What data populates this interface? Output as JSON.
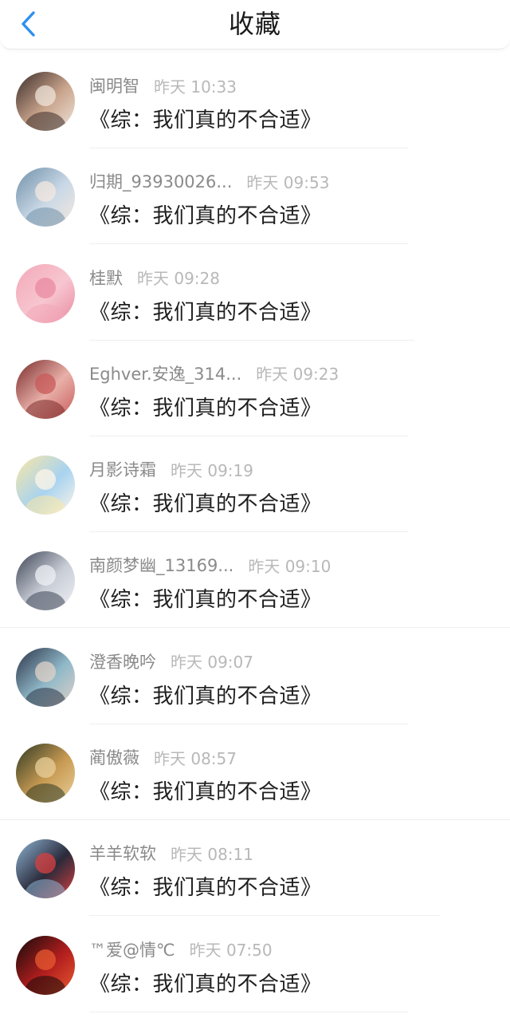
{
  "header": {
    "title": "收藏",
    "back_icon": "chevron-left-icon",
    "accent_color": "#2f8ff0"
  },
  "items": [
    {
      "name": "闽明智",
      "time": "昨天 10:33",
      "message": "《综：我们真的不合适》",
      "avatar_colors": [
        "#3a2c28",
        "#c9a48c",
        "#efe4da"
      ]
    },
    {
      "name": "归期_93930026...",
      "time": "昨天 09:53",
      "message": "《综：我们真的不合适》",
      "avatar_colors": [
        "#6f8fa8",
        "#c9d8e6",
        "#f4e8e0"
      ]
    },
    {
      "name": "桂默",
      "time": "昨天 09:28",
      "message": "《综：我们真的不合适》",
      "avatar_colors": [
        "#f3a8b8",
        "#f7c6d0",
        "#e98aa0"
      ]
    },
    {
      "name": "Eghver.安逸_314...",
      "time": "昨天 09:23",
      "message": "《综：我们真的不合适》",
      "avatar_colors": [
        "#7a2a2a",
        "#e8b0a8",
        "#c85a5a"
      ]
    },
    {
      "name": "月影诗霜",
      "time": "昨天 09:19",
      "message": "《综：我们真的不合适》",
      "avatar_colors": [
        "#fbe7a4",
        "#a8d3f0",
        "#fff6e8"
      ]
    },
    {
      "name": "南颜梦幽_13169...",
      "time": "昨天 09:10",
      "message": "《综：我们真的不合适》",
      "avatar_colors": [
        "#3d4454",
        "#c8cdd6",
        "#eef0f4"
      ]
    },
    {
      "name": "澄香晚吟",
      "time": "昨天 09:07",
      "message": "《综：我们真的不合适》",
      "avatar_colors": [
        "#2a3346",
        "#8fb8c8",
        "#e0d2c8"
      ]
    },
    {
      "name": "蔺傲薇",
      "time": "昨天 08:57",
      "message": "《综：我们真的不合适》",
      "avatar_colors": [
        "#2f3a24",
        "#c89a52",
        "#e8cf9a"
      ]
    },
    {
      "name": "羊羊软软",
      "time": "昨天 08:11",
      "message": "《综：我们真的不合适》",
      "avatar_colors": [
        "#8fb6d6",
        "#2a2a3a",
        "#d84040"
      ]
    },
    {
      "name": "™爱@情℃",
      "time": "昨天 07:50",
      "message": "《综：我们真的不合适》",
      "avatar_colors": [
        "#120a0a",
        "#b21e1e",
        "#e85a30"
      ]
    }
  ]
}
